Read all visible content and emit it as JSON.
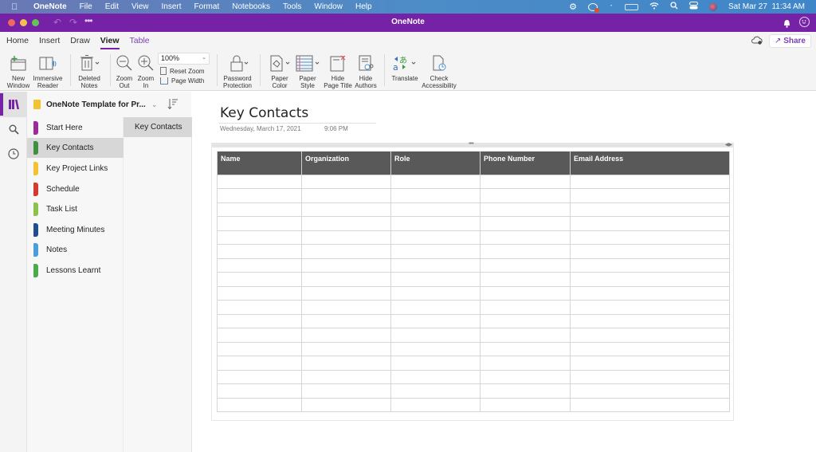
{
  "menubar": {
    "app_name": "OneNote",
    "items": [
      "File",
      "Edit",
      "View",
      "Insert",
      "Format",
      "Notebooks",
      "Tools",
      "Window",
      "Help"
    ],
    "status_icons": [
      "gear-icon",
      "screen-record-icon",
      "bluetooth-icon",
      "battery-icon",
      "wifi-icon",
      "spotlight-search-icon",
      "control-center-icon",
      "siri-icon"
    ],
    "clock": "Sat Mar 27  11:34 AM"
  },
  "titlebar": {
    "title": "OneNote",
    "undo_icon": "↶",
    "redo_icon": "↷",
    "more_icon": "•••"
  },
  "ribbon_tabs": [
    {
      "label": "Home",
      "state": "normal"
    },
    {
      "label": "Insert",
      "state": "normal"
    },
    {
      "label": "Draw",
      "state": "normal"
    },
    {
      "label": "View",
      "state": "active"
    },
    {
      "label": "Table",
      "state": "contextual"
    }
  ],
  "share": {
    "label": "Share"
  },
  "ribbon": {
    "new_window": {
      "line1": "New",
      "line2": "Window"
    },
    "immersive_reader": {
      "line1": "Immersive",
      "line2": "Reader"
    },
    "deleted_notes": {
      "line1": "Deleted",
      "line2": "Notes"
    },
    "zoom_out": {
      "line1": "Zoom",
      "line2": "Out"
    },
    "zoom_in": {
      "line1": "Zoom",
      "line2": "In"
    },
    "zoom_level": "100%",
    "reset_zoom": "Reset Zoom",
    "page_width": "Page Width",
    "password_protection": {
      "line1": "Password",
      "line2": "Protection"
    },
    "paper_color": {
      "line1": "Paper",
      "line2": "Color"
    },
    "paper_style": {
      "line1": "Paper",
      "line2": "Style"
    },
    "hide_page_title": {
      "line1": "Hide",
      "line2": "Page Title"
    },
    "hide_authors": {
      "line1": "Hide",
      "line2": "Authors"
    },
    "translate": {
      "line1": "Translate",
      "line2": ""
    },
    "check_accessibility": {
      "line1": "Check",
      "line2": "Accessibility"
    }
  },
  "notebook": {
    "name": "OneNote Template for Pr..."
  },
  "sections": [
    {
      "label": "Start Here",
      "color": "#9b2a9b",
      "active": false
    },
    {
      "label": "Key Contacts",
      "color": "#3f8f3f",
      "active": true
    },
    {
      "label": "Key Project Links",
      "color": "#f2c230",
      "active": false
    },
    {
      "label": "Schedule",
      "color": "#d43a2f",
      "active": false
    },
    {
      "label": "Task List",
      "color": "#8cc24a",
      "active": false
    },
    {
      "label": "Meeting Minutes",
      "color": "#1f4e8c",
      "active": false
    },
    {
      "label": "Notes",
      "color": "#4a9edb",
      "active": false
    },
    {
      "label": "Lessons Learnt",
      "color": "#4caa4c",
      "active": false
    }
  ],
  "pages": [
    {
      "label": "Key Contacts",
      "active": true
    }
  ],
  "page": {
    "title": "Key Contacts",
    "date": "Wednesday, March 17, 2021",
    "time": "9:06 PM"
  },
  "table": {
    "headers": [
      "Name",
      "Organization",
      "Role",
      "Phone Number",
      "Email Address"
    ],
    "rows": [
      [
        "",
        "",
        "",
        "",
        ""
      ],
      [
        "",
        "",
        "",
        "",
        ""
      ],
      [
        "",
        "",
        "",
        "",
        ""
      ],
      [
        "",
        "",
        "",
        "",
        ""
      ],
      [
        "",
        "",
        "",
        "",
        ""
      ],
      [
        "",
        "",
        "",
        "",
        ""
      ],
      [
        "",
        "",
        "",
        "",
        ""
      ],
      [
        "",
        "",
        "",
        "",
        ""
      ],
      [
        "",
        "",
        "",
        "",
        ""
      ],
      [
        "",
        "",
        "",
        "",
        ""
      ],
      [
        "",
        "",
        "",
        "",
        ""
      ],
      [
        "",
        "",
        "",
        "",
        ""
      ],
      [
        "",
        "",
        "",
        "",
        ""
      ],
      [
        "",
        "",
        "",
        "",
        ""
      ],
      [
        "",
        "",
        "",
        "",
        ""
      ],
      [
        "",
        "",
        "",
        "",
        ""
      ],
      [
        "",
        "",
        "",
        "",
        ""
      ]
    ]
  },
  "colors": {
    "accent": "#7622a6",
    "table_header_bg": "#595959",
    "traffic_red": "#ed6a5e",
    "traffic_yellow": "#f5bf4f",
    "traffic_green": "#61c554"
  }
}
